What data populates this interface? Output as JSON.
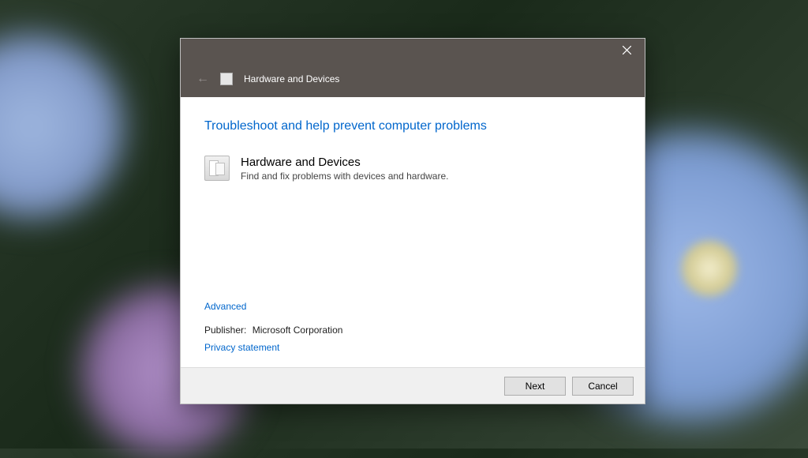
{
  "titlebar": {
    "back_arrow": "←",
    "title": "Hardware and Devices"
  },
  "content": {
    "heading": "Troubleshoot and help prevent computer problems",
    "item": {
      "title": "Hardware and Devices",
      "description": "Find and fix problems with devices and hardware."
    },
    "advanced": "Advanced",
    "publisher_label": "Publisher:",
    "publisher_value": "Microsoft Corporation",
    "privacy": "Privacy statement"
  },
  "footer": {
    "next": "Next",
    "cancel": "Cancel"
  }
}
